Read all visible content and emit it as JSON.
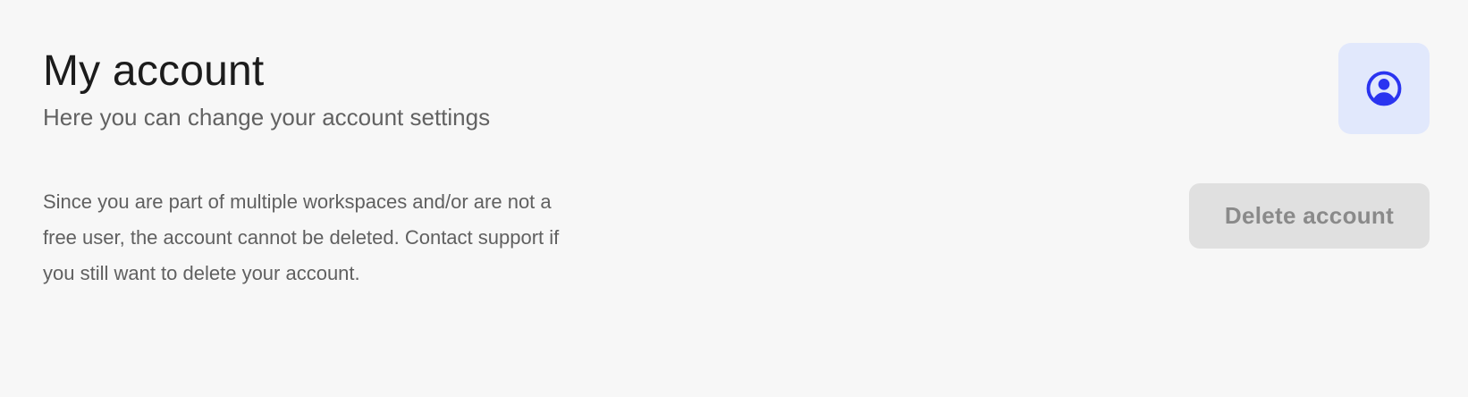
{
  "header": {
    "title": "My account",
    "subtitle": "Here you can change your account settings"
  },
  "account_icon": {
    "icon": "user-circle-icon",
    "color": "#2a34f0",
    "background": "#e1e8fc"
  },
  "notice": {
    "text": "Since you are part of multiple workspaces and/or are not a free user, the account cannot be deleted. Contact support if you still want to delete your account."
  },
  "actions": {
    "delete_label": "Delete account",
    "delete_disabled": true
  }
}
